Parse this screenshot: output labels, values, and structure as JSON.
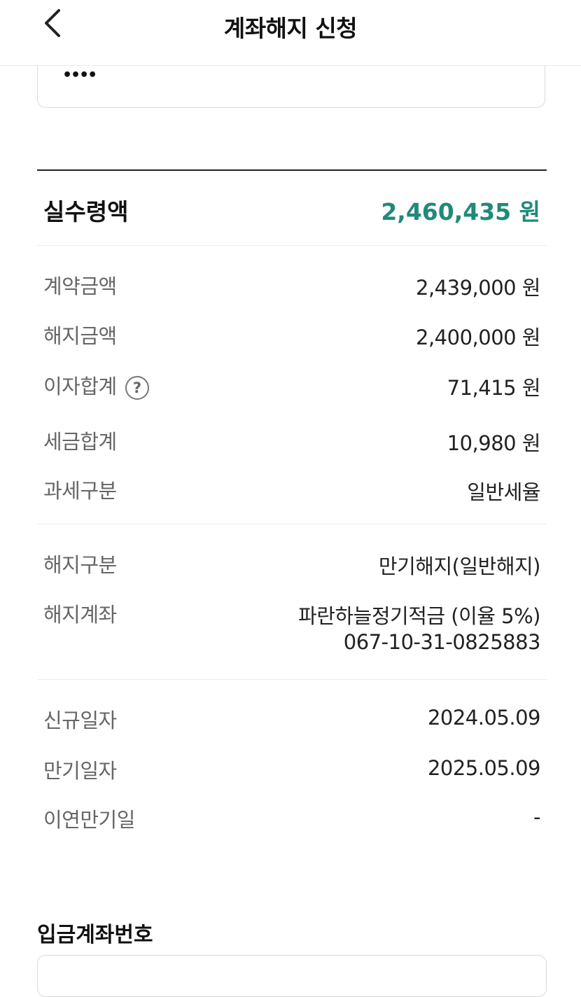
{
  "header": {
    "title": "계좌해지 신청",
    "back_icon": "chevron-left-icon"
  },
  "password": {
    "masked_value": "••••"
  },
  "summary": {
    "net_label": "실수령액",
    "net_value": "2,460,435 원",
    "net_color": "#1f8a78"
  },
  "amounts": [
    {
      "label": "계약금액",
      "value": "2,439,000 원"
    },
    {
      "label": "해지금액",
      "value": "2,400,000 원"
    },
    {
      "label": "이자합계",
      "value": "71,415 원"
    },
    {
      "label": "세금합계",
      "value": "10,980 원"
    },
    {
      "label": "과세구분",
      "value": "일반세율"
    }
  ],
  "cancel": {
    "type_label": "해지구분",
    "type_value": "만기해지(일반해지)",
    "account_label": "해지계좌",
    "account_name": "파란하늘정기적금 (이율 5%)",
    "account_number": "067-10-31-0825883"
  },
  "dates": [
    {
      "label": "신규일자",
      "value": "2024.05.09"
    },
    {
      "label": "만기일자",
      "value": "2025.05.09"
    },
    {
      "label": "이연만기일",
      "value": "-"
    }
  ],
  "deposit": {
    "title": "입금계좌번호"
  },
  "help_glyph": "?"
}
